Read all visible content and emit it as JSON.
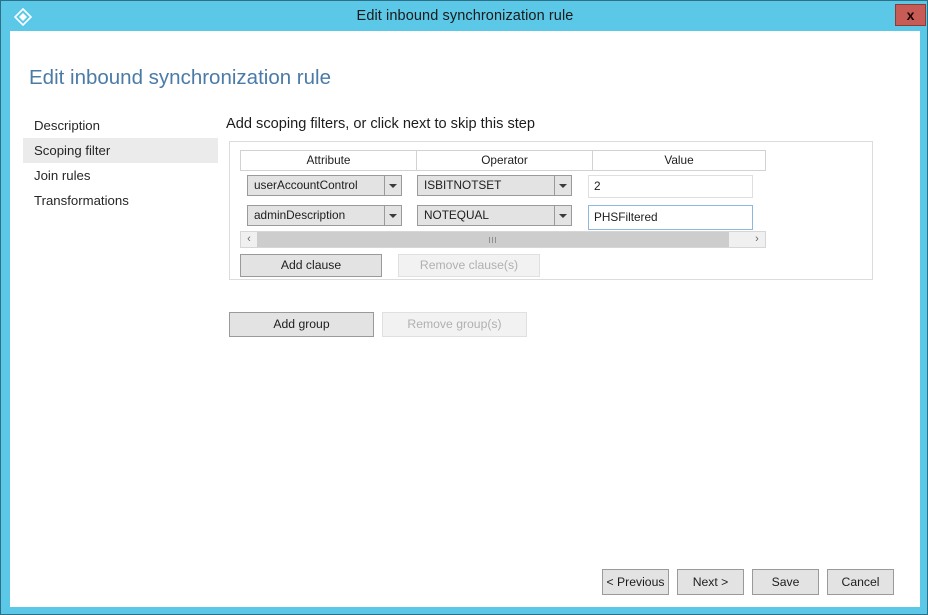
{
  "window": {
    "title": "Edit inbound synchronization rule",
    "app_icon": "sync-diamond-icon",
    "close_label": "x",
    "titlebar_color": "#5bc8e8",
    "close_button_color": "#c75b56"
  },
  "page": {
    "heading": "Edit inbound synchronization rule",
    "heading_color": "#4a7ba8"
  },
  "sidebar": {
    "items": [
      {
        "label": "Description",
        "selected": false
      },
      {
        "label": "Scoping filter",
        "selected": true
      },
      {
        "label": "Join rules",
        "selected": false
      },
      {
        "label": "Transformations",
        "selected": false
      }
    ],
    "selected_background": "#ebebeb"
  },
  "main": {
    "instruction": "Add scoping filters, or click next to skip this step",
    "table": {
      "columns": [
        "Attribute",
        "Operator",
        "Value"
      ],
      "rows": [
        {
          "attribute": "userAccountControl",
          "operator": "ISBITNOTSET",
          "value": "2",
          "value_focused": false
        },
        {
          "attribute": "adminDescription",
          "operator": "NOTEQUAL",
          "value": "PHSFiltered",
          "value_focused": true
        }
      ]
    },
    "scrollbar": {
      "left_arrow": "‹",
      "right_arrow": "›"
    },
    "clause_buttons": {
      "add": {
        "label": "Add clause",
        "enabled": true
      },
      "remove": {
        "label": "Remove clause(s)",
        "enabled": false
      }
    },
    "group_buttons": {
      "add": {
        "label": "Add group",
        "enabled": true
      },
      "remove": {
        "label": "Remove group(s)",
        "enabled": false
      }
    }
  },
  "footer": {
    "previous": "< Previous",
    "next": "Next >",
    "save": "Save",
    "cancel": "Cancel"
  }
}
